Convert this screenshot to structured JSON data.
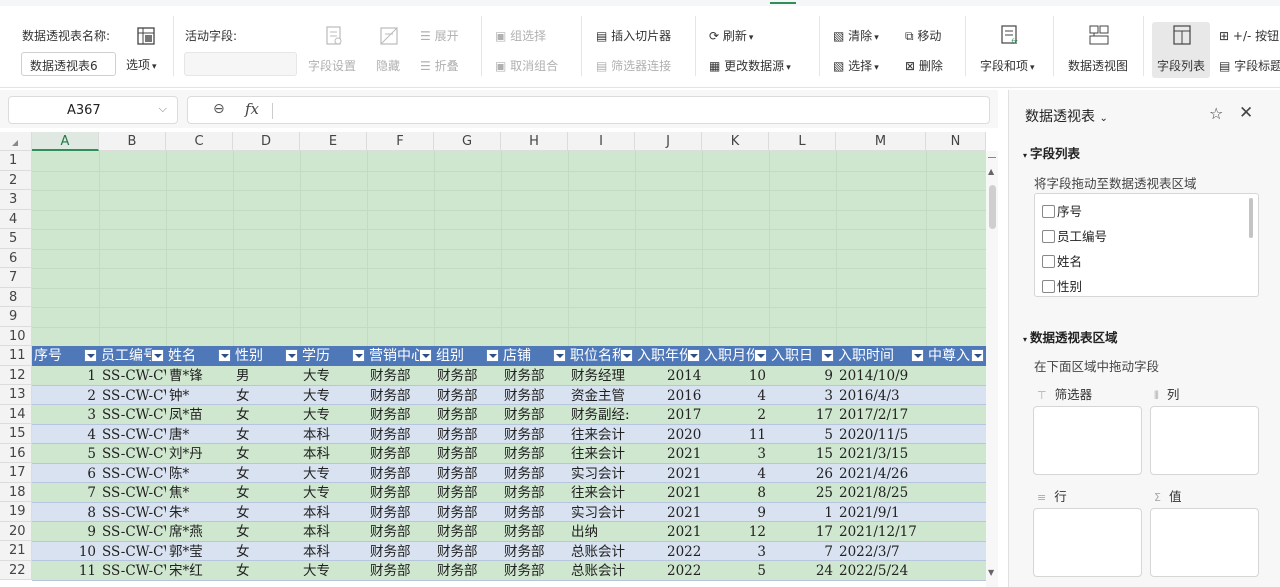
{
  "ribbon": {
    "pivot_name_label": "数据透视表名称:",
    "pivot_name_value": "数据透视表6",
    "options_label": "选项",
    "active_field_label": "活动字段:",
    "field_settings": "字段设置",
    "hide": "隐藏",
    "expand": "展开",
    "collapse": "折叠",
    "group_select": "组选择",
    "ungroup": "取消组合",
    "insert_slicer": "插入切片器",
    "filter_connect": "筛选器连接",
    "refresh": "刷新",
    "change_source": "更改数据源",
    "clear": "清除",
    "select": "选择",
    "move": "移动",
    "delete": "删除",
    "fields_items": "字段和项",
    "pivot_view": "数据透视图",
    "field_list": "字段列表",
    "buttons": "+/- 按钮",
    "field_headers": "字段标题"
  },
  "formula_bar": {
    "name_box": "A367",
    "zoom_icon": "magnifier-icon",
    "fx": "fx",
    "content": ""
  },
  "sheet": {
    "columns": [
      "A",
      "B",
      "C",
      "D",
      "E",
      "F",
      "G",
      "H",
      "I",
      "J",
      "K",
      "L",
      "M",
      "N"
    ],
    "selected_column": "A",
    "row_numbers": [
      "1",
      "2",
      "3",
      "4",
      "5",
      "6",
      "7",
      "8",
      "9",
      "10",
      "11",
      "12",
      "13",
      "14",
      "15",
      "16",
      "17",
      "18",
      "19",
      "20",
      "21",
      "22"
    ],
    "table_headers": [
      "序号",
      "员工编号",
      "姓名",
      "性别",
      "学历",
      "营销中心",
      "组别",
      "店铺",
      "职位名称",
      "入职年份",
      "入职月份",
      "入职日",
      "入职时间",
      "中尊入"
    ],
    "rows": [
      [
        "1",
        "SS-CW-CW-",
        "曹*锋",
        "男",
        "大专",
        "财务部",
        "财务部",
        "财务部",
        "财务经理",
        "2014",
        "10",
        "9",
        "2014/10/9"
      ],
      [
        "2",
        "SS-CW-CW-",
        "钟*",
        "女",
        "大专",
        "财务部",
        "财务部",
        "财务部",
        "资金主管",
        "2016",
        "4",
        "3",
        "2016/4/3"
      ],
      [
        "3",
        "SS-CW-CW-",
        "凤*苗",
        "女",
        "大专",
        "财务部",
        "财务部",
        "财务部",
        "财务副经:",
        "2017",
        "2",
        "17",
        "2017/2/17"
      ],
      [
        "4",
        "SS-CW-CW-",
        "唐*",
        "女",
        "本科",
        "财务部",
        "财务部",
        "财务部",
        "往来会计",
        "2020",
        "11",
        "5",
        "2020/11/5"
      ],
      [
        "5",
        "SS-CW-CW-",
        "刘*丹",
        "女",
        "本科",
        "财务部",
        "财务部",
        "财务部",
        "往来会计",
        "2021",
        "3",
        "15",
        "2021/3/15"
      ],
      [
        "6",
        "SS-CW-CW-",
        "陈*",
        "女",
        "大专",
        "财务部",
        "财务部",
        "财务部",
        "实习会计",
        "2021",
        "4",
        "26",
        "2021/4/26"
      ],
      [
        "7",
        "SS-CW-CW-",
        "焦*",
        "女",
        "大专",
        "财务部",
        "财务部",
        "财务部",
        "往来会计",
        "2021",
        "8",
        "25",
        "2021/8/25"
      ],
      [
        "8",
        "SS-CW-CW-",
        "朱*",
        "女",
        "本科",
        "财务部",
        "财务部",
        "财务部",
        "实习会计",
        "2021",
        "9",
        "1",
        "2021/9/1"
      ],
      [
        "9",
        "SS-CW-CW-",
        "席*燕",
        "女",
        "本科",
        "财务部",
        "财务部",
        "财务部",
        "出纳",
        "2021",
        "12",
        "17",
        "2021/12/17"
      ],
      [
        "10",
        "SS-CW-CW-",
        "郭*莹",
        "女",
        "本科",
        "财务部",
        "财务部",
        "财务部",
        "总账会计",
        "2022",
        "3",
        "7",
        "2022/3/7"
      ],
      [
        "11",
        "SS-CW-CW-",
        "宋*红",
        "女",
        "大专",
        "财务部",
        "财务部",
        "财务部",
        "总账会计",
        "2022",
        "5",
        "24",
        "2022/5/24"
      ]
    ]
  },
  "pane": {
    "title": "数据透视表",
    "field_list_section": "字段列表",
    "field_list_hint": "将字段拖动至数据透视表区域",
    "fields": [
      "序号",
      "员工编号",
      "姓名",
      "性别"
    ],
    "areas_section": "数据透视表区域",
    "areas_hint": "在下面区域中拖动字段",
    "filters": "筛选器",
    "columns": "列",
    "rows": "行",
    "values": "值"
  },
  "colors": {
    "green_fill": "#cfe6cf",
    "blue_header": "#4f78b8",
    "blue_band": "#d9e2f0",
    "accent": "#2f8e5a"
  }
}
